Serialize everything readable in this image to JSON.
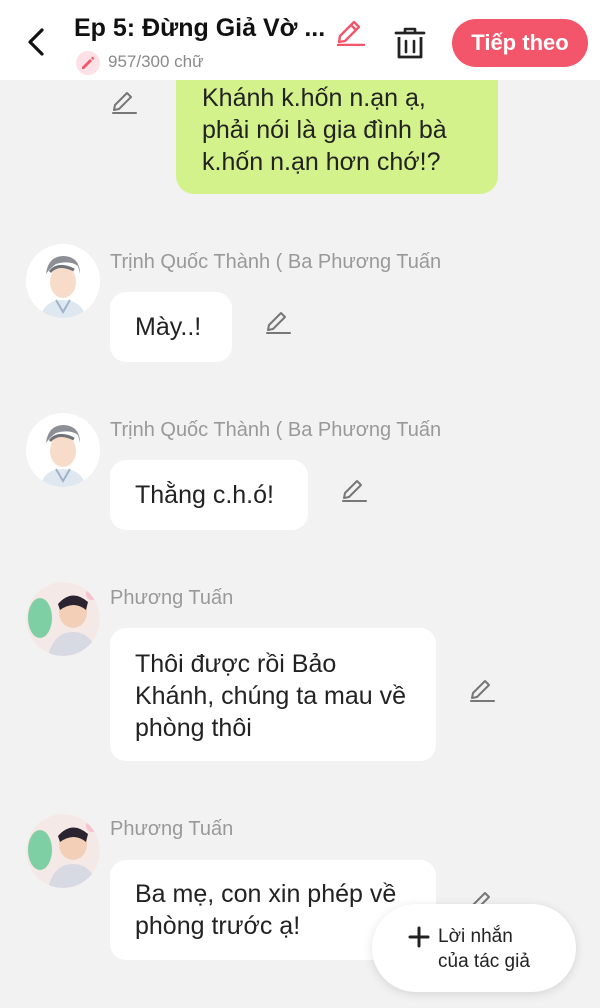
{
  "header": {
    "title": "Ep 5: Đừng Giả Vờ ...",
    "word_count": "957/300 chữ",
    "next_label": "Tiếp theo",
    "accent_color": "#f3556b"
  },
  "own_message": {
    "text": "Khánh k.hốn n.ạn ạ, phải nói là gia đình bà k.hốn n.ạn hơn chớ!?",
    "bubble_color": "#d4f28b"
  },
  "messages": [
    {
      "sender": "Trịnh Quốc Thành ( Ba Phương Tuấn",
      "text": "Mày..!",
      "avatar": "anime-man-avatar"
    },
    {
      "sender": "Trịnh Quốc Thành ( Ba Phương Tuấn",
      "text": "Thằng c.h.ó!",
      "avatar": "anime-man-avatar"
    },
    {
      "sender": "Phương Tuấn",
      "text": "Thôi được rồi Bảo Khánh, chúng ta mau về phòng thôi",
      "avatar": "photo-avatar"
    },
    {
      "sender": "Phương Tuấn",
      "text": "Ba mẹ, con xin phép về phòng trước ạ!",
      "avatar": "photo-avatar"
    }
  ],
  "fab": {
    "line1": "Lời nhắn",
    "line2": "của tác giả"
  },
  "icons": {
    "back": "chevron-left-icon",
    "edit": "pencil-icon",
    "delete": "trash-icon",
    "add": "plus-icon"
  }
}
